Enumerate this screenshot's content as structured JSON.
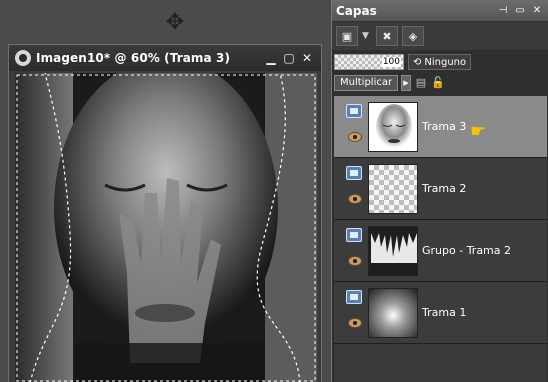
{
  "image_window": {
    "title": "Imagen10* @  60% (Trama 3)",
    "icons": {
      "app": "circle-logo-icon",
      "minimize": "minimize-icon",
      "maximize": "maximize-icon",
      "close": "close-icon"
    }
  },
  "workspace": {
    "logo": "shield-logo-icon"
  },
  "layers_panel": {
    "title": "Capas",
    "title_buttons": [
      "pin-icon",
      "restore-icon",
      "close-icon"
    ],
    "toolbar": [
      "new-layer-icon",
      "delete-layer-icon",
      "mask-icon"
    ],
    "opacity_value": "100",
    "mask_label": "Ninguno",
    "blend_mode": "Multiplicar",
    "layers": [
      {
        "name": "Trama 3",
        "selected": true,
        "thumb": "face"
      },
      {
        "name": "Trama 2",
        "selected": false,
        "thumb": "checker"
      },
      {
        "name": "Grupo - Trama 2",
        "selected": false,
        "thumb": "group"
      },
      {
        "name": "Trama 1",
        "selected": false,
        "thumb": "radial"
      }
    ]
  },
  "colors": {
    "workspace_bg": "#4b4b4b",
    "panel_bg": "#2f2f2f",
    "selected_row": "#8a8a8a",
    "pointer": "#f2c300"
  }
}
